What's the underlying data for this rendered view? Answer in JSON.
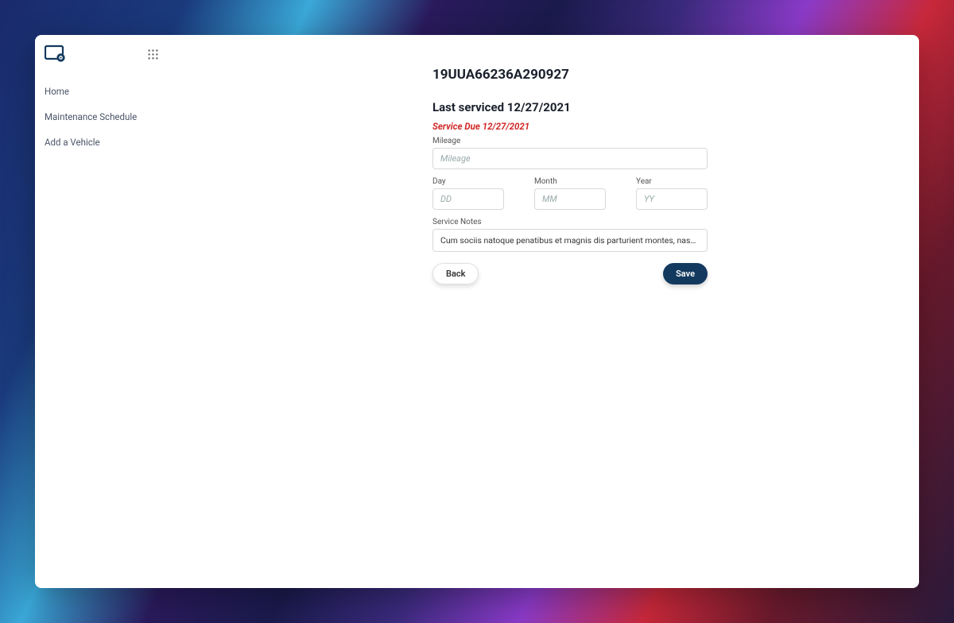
{
  "sidebar": {
    "nav": [
      {
        "label": "Home"
      },
      {
        "label": "Maintenance Schedule"
      },
      {
        "label": "Add a Vehicle"
      }
    ]
  },
  "main": {
    "title": "19UUA66236A290927",
    "last_serviced": "Last serviced 12/27/2021",
    "service_due": "Service Due 12/27/2021",
    "mileage": {
      "label": "Mileage",
      "placeholder": "Mileage",
      "value": ""
    },
    "day": {
      "label": "Day",
      "placeholder": "DD",
      "value": ""
    },
    "month": {
      "label": "Month",
      "placeholder": "MM",
      "value": ""
    },
    "year": {
      "label": "Year",
      "placeholder": "YY",
      "value": ""
    },
    "service_notes": {
      "label": "Service Notes",
      "value": "Cum sociis natoque penatibus et magnis dis parturient montes, nascetur ridiculus mus. Vivamus …"
    },
    "buttons": {
      "back": "Back",
      "save": "Save"
    }
  },
  "colors": {
    "danger": "#d02a2a",
    "primary": "#13395e"
  }
}
